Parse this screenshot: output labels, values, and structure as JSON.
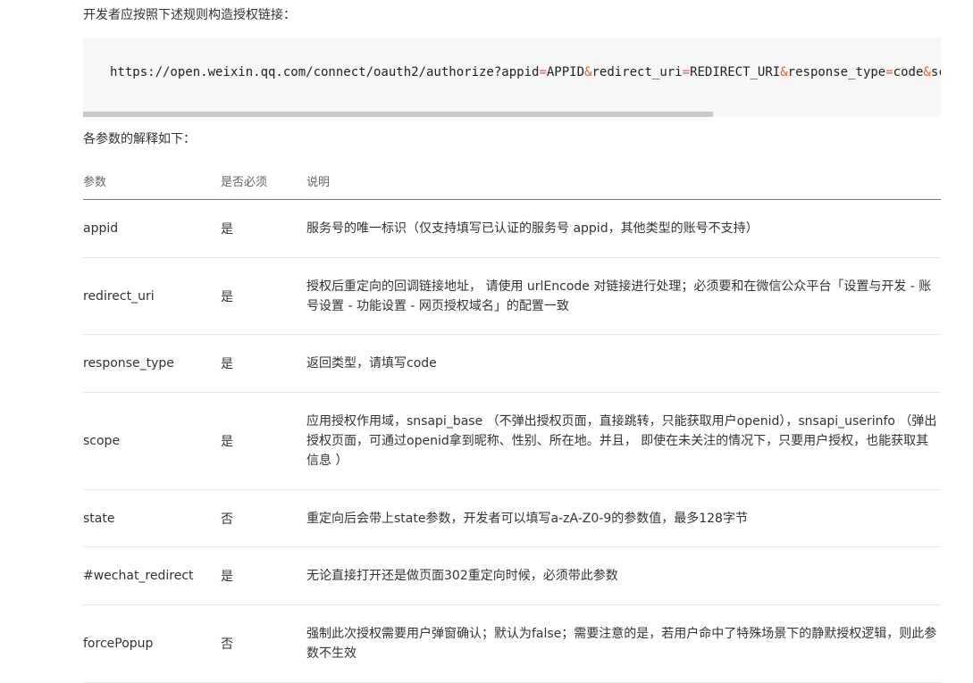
{
  "intro": "开发者应按照下述规则构造授权链接：",
  "url_parts": [
    {
      "t": "https://open.weixin.qq.com/connect/oauth2/authorize?appid",
      "op": false
    },
    {
      "t": "=",
      "op": true
    },
    {
      "t": "APPID",
      "op": false
    },
    {
      "t": "&",
      "op": true
    },
    {
      "t": "redirect_uri",
      "op": false
    },
    {
      "t": "=",
      "op": true
    },
    {
      "t": "REDIRECT_URI",
      "op": false
    },
    {
      "t": "&",
      "op": true
    },
    {
      "t": "response_type",
      "op": false
    },
    {
      "t": "=",
      "op": true
    },
    {
      "t": "code",
      "op": false
    },
    {
      "t": "&",
      "op": true
    },
    {
      "t": "sc",
      "op": false
    }
  ],
  "params_caption": "各参数的解释如下：",
  "table": {
    "headers": {
      "param": "参数",
      "required": "是否必须",
      "desc": "说明"
    },
    "rows": [
      {
        "param": "appid",
        "required": "是",
        "desc": "服务号的唯一标识（仅支持填写已认证的服务号 appid，其他类型的账号不支持）"
      },
      {
        "param": "redirect_uri",
        "required": "是",
        "desc": "授权后重定向的回调链接地址， 请使用 urlEncode 对链接进行处理；必须要和在微信公众平台「设置与开发 - 账号设置 - 功能设置 - 网页授权域名」的配置一致"
      },
      {
        "param": "response_type",
        "required": "是",
        "desc": "返回类型，请填写code"
      },
      {
        "param": "scope",
        "required": "是",
        "desc": "应用授权作用域，snsapi_base （不弹出授权页面，直接跳转，只能获取用户openid），snsapi_userinfo （弹出授权页面，可通过openid拿到昵称、性别、所在地。并且， 即使在未关注的情况下，只要用户授权，也能获取其信息 ）"
      },
      {
        "param": "state",
        "required": "否",
        "desc": "重定向后会带上state参数，开发者可以填写a-zA-Z0-9的参数值，最多128字节"
      },
      {
        "param": "#wechat_redirect",
        "required": "是",
        "desc": "无论直接打开还是做页面302重定向时候，必须带此参数"
      },
      {
        "param": "forcePopup",
        "required": "否",
        "desc": "强制此次授权需要用户弹窗确认；默认为false；需要注意的是，若用户命中了特殊场景下的静默授权逻辑，则此参数不生效"
      }
    ]
  },
  "colors": {
    "operator": "#e05f3c",
    "code_bg": "#f7f7f7"
  }
}
